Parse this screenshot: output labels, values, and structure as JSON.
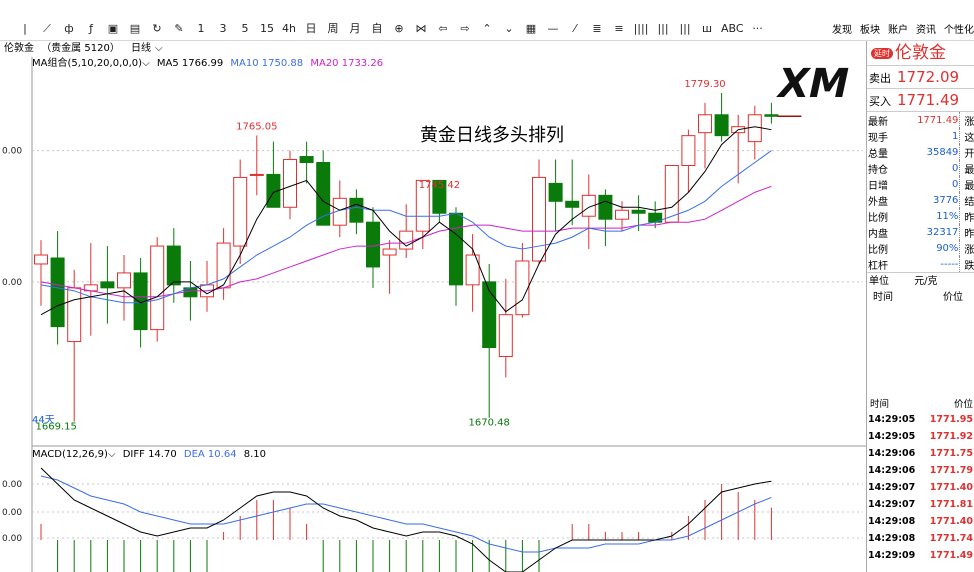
{
  "toolbar": {
    "icons": [
      {
        "name": "separator-icon",
        "glyph": "|"
      },
      {
        "name": "line-chart-icon",
        "glyph": "⟋"
      },
      {
        "name": "candle-icon",
        "glyph": "ф"
      },
      {
        "name": "indicator-icon",
        "glyph": "ƒ"
      },
      {
        "name": "chart-box-icon",
        "glyph": "▣"
      },
      {
        "name": "save-icon",
        "glyph": "▤"
      },
      {
        "name": "refresh-icon",
        "glyph": "↻"
      },
      {
        "name": "draw-icon",
        "glyph": "✎"
      },
      {
        "name": "period-1-icon",
        "glyph": "1"
      },
      {
        "name": "period-3-icon",
        "glyph": "3"
      },
      {
        "name": "period-5-icon",
        "glyph": "5"
      },
      {
        "name": "period-15-icon",
        "glyph": "15"
      },
      {
        "name": "period-4h-icon",
        "glyph": "4h"
      },
      {
        "name": "period-day-icon",
        "glyph": "日"
      },
      {
        "name": "period-week-icon",
        "glyph": "周"
      },
      {
        "name": "period-month-icon",
        "glyph": "月"
      },
      {
        "name": "period-custom-icon",
        "glyph": "自"
      },
      {
        "name": "target-icon",
        "glyph": "⊕"
      },
      {
        "name": "bowtie-icon",
        "glyph": "⋈"
      },
      {
        "name": "arrow-left-icon",
        "glyph": "⇦"
      },
      {
        "name": "arrow-right-icon",
        "glyph": "⇨"
      },
      {
        "name": "chevron-up-icon",
        "glyph": "⌃"
      },
      {
        "name": "chevron-down-icon",
        "glyph": "⌄"
      },
      {
        "name": "grid-icon",
        "glyph": "▦"
      },
      {
        "name": "hline-icon",
        "glyph": "—"
      },
      {
        "name": "slash-icon",
        "glyph": "⁄"
      },
      {
        "name": "list-icon",
        "glyph": "≣"
      },
      {
        "name": "list2-icon",
        "glyph": "≡"
      },
      {
        "name": "bars4-icon",
        "glyph": "||||"
      },
      {
        "name": "bars3-icon",
        "glyph": "|||"
      },
      {
        "name": "bars2-icon",
        "glyph": "|||"
      },
      {
        "name": "volume-icon",
        "glyph": "ш"
      },
      {
        "name": "abc-icon",
        "glyph": "ABC"
      },
      {
        "name": "more-icon",
        "glyph": "···"
      }
    ],
    "right": [
      "发现",
      "板块",
      "账户",
      "资讯",
      "个性化"
    ]
  },
  "symbol_bar": {
    "name": "伦敦金",
    "market": "（贵金属 5120）",
    "period": "日线"
  },
  "ma_legend": {
    "group": "MA组合(5,10,20,0,0,0)",
    "ma5": "MA5 1766.99",
    "ma10": "MA10 1750.88",
    "ma20": "MA20 1733.26"
  },
  "macd_legend": {
    "title": "MACD(12,26,9)",
    "diff": "DIFF 14.70",
    "dea": "DEA 10.64",
    "macd": "8.10"
  },
  "overlay_title": "黄金日线多头排列",
  "logo_text": "XM",
  "colors": {
    "up": "#e03030",
    "down": "#0a7a0a",
    "ma5": "#000000",
    "ma10": "#3a6ee8",
    "ma20": "#cc22cc",
    "grid": "#c8c8c8"
  },
  "chart_data": {
    "type": "candlestick",
    "ylim": [
      1661,
      1787
    ],
    "y_ticks": [
      {
        "value": 1760,
        "label": "0.00"
      },
      {
        "value": 1716,
        "label": "0.00"
      }
    ],
    "macd_ticks": [
      {
        "label": "0.00"
      },
      {
        "label": "0.00"
      },
      {
        "label": "0.00"
      }
    ],
    "annotations": [
      {
        "label": "1765.05",
        "index": 13,
        "value": 1765.05,
        "color": "red"
      },
      {
        "label": "1745.42",
        "index": 24,
        "value": 1745.42,
        "color": "red"
      },
      {
        "label": "1779.30",
        "index": 40,
        "value": 1779.3,
        "color": "red"
      },
      {
        "label": "1669.15",
        "index": 2,
        "value": 1669.15,
        "color": "green"
      },
      {
        "label": "1670.48",
        "index": 27,
        "value": 1670.48,
        "color": "green"
      },
      {
        "label": "44天",
        "index": 0,
        "value": 1669,
        "color": "blue"
      }
    ],
    "candles": [
      {
        "o": 1722,
        "h": 1730,
        "l": 1708,
        "c": 1725
      },
      {
        "o": 1724,
        "h": 1733,
        "l": 1695,
        "c": 1701
      },
      {
        "o": 1696,
        "h": 1720,
        "l": 1669.15,
        "c": 1714
      },
      {
        "o": 1713,
        "h": 1729,
        "l": 1698,
        "c": 1715
      },
      {
        "o": 1716,
        "h": 1728,
        "l": 1702,
        "c": 1714
      },
      {
        "o": 1714,
        "h": 1725,
        "l": 1703,
        "c": 1719
      },
      {
        "o": 1719,
        "h": 1724,
        "l": 1694,
        "c": 1700
      },
      {
        "o": 1700,
        "h": 1731,
        "l": 1696,
        "c": 1728
      },
      {
        "o": 1728,
        "h": 1734,
        "l": 1709,
        "c": 1715
      },
      {
        "o": 1714,
        "h": 1723,
        "l": 1703,
        "c": 1711
      },
      {
        "o": 1711,
        "h": 1723,
        "l": 1706,
        "c": 1715
      },
      {
        "o": 1714,
        "h": 1734,
        "l": 1710,
        "c": 1729
      },
      {
        "o": 1728,
        "h": 1757,
        "l": 1722,
        "c": 1751
      },
      {
        "o": 1752,
        "h": 1765.05,
        "l": 1745,
        "c": 1752
      },
      {
        "o": 1752,
        "h": 1763,
        "l": 1743,
        "c": 1741
      },
      {
        "o": 1741,
        "h": 1760,
        "l": 1737,
        "c": 1757
      },
      {
        "o": 1758,
        "h": 1763,
        "l": 1749,
        "c": 1756
      },
      {
        "o": 1756,
        "h": 1760,
        "l": 1742,
        "c": 1735
      },
      {
        "o": 1735,
        "h": 1750,
        "l": 1731,
        "c": 1744
      },
      {
        "o": 1744,
        "h": 1747,
        "l": 1732,
        "c": 1736
      },
      {
        "o": 1736,
        "h": 1741,
        "l": 1714,
        "c": 1721
      },
      {
        "o": 1725,
        "h": 1730,
        "l": 1712,
        "c": 1727
      },
      {
        "o": 1727,
        "h": 1742,
        "l": 1724,
        "c": 1733
      },
      {
        "o": 1733,
        "h": 1749,
        "l": 1727,
        "c": 1750
      },
      {
        "o": 1750,
        "h": 1745.42,
        "l": 1736,
        "c": 1739
      },
      {
        "o": 1739,
        "h": 1741,
        "l": 1708,
        "c": 1715
      },
      {
        "o": 1715,
        "h": 1732,
        "l": 1706,
        "c": 1725
      },
      {
        "o": 1716,
        "h": 1722,
        "l": 1670.48,
        "c": 1694
      },
      {
        "o": 1691,
        "h": 1717,
        "l": 1684,
        "c": 1705
      },
      {
        "o": 1705,
        "h": 1729,
        "l": 1704,
        "c": 1723
      },
      {
        "o": 1723,
        "h": 1757,
        "l": 1722,
        "c": 1751
      },
      {
        "o": 1749,
        "h": 1757,
        "l": 1733,
        "c": 1743
      },
      {
        "o": 1743,
        "h": 1757,
        "l": 1735,
        "c": 1741
      },
      {
        "o": 1738,
        "h": 1752,
        "l": 1727,
        "c": 1745
      },
      {
        "o": 1745,
        "h": 1747,
        "l": 1728,
        "c": 1737
      },
      {
        "o": 1737,
        "h": 1743,
        "l": 1733,
        "c": 1740
      },
      {
        "o": 1740,
        "h": 1745,
        "l": 1733,
        "c": 1739
      },
      {
        "o": 1739,
        "h": 1743,
        "l": 1734,
        "c": 1736
      },
      {
        "o": 1736,
        "h": 1755,
        "l": 1736,
        "c": 1755
      },
      {
        "o": 1755,
        "h": 1767,
        "l": 1746,
        "c": 1765
      },
      {
        "o": 1766,
        "h": 1776,
        "l": 1754,
        "c": 1772
      },
      {
        "o": 1772,
        "h": 1779.3,
        "l": 1763,
        "c": 1765
      },
      {
        "o": 1766,
        "h": 1772,
        "l": 1749,
        "c": 1768
      },
      {
        "o": 1763,
        "h": 1775,
        "l": 1757,
        "c": 1772
      },
      {
        "o": 1772,
        "h": 1776,
        "l": 1769,
        "c": 1771.49
      }
    ],
    "ma5": [
      1705,
      1708,
      1710,
      1711,
      1712,
      1713,
      1709,
      1711,
      1716,
      1716,
      1712,
      1715,
      1725,
      1737,
      1746,
      1748,
      1750,
      1743,
      1740,
      1742,
      1740,
      1733,
      1728,
      1731,
      1736,
      1732,
      1727,
      1713,
      1706,
      1710,
      1722,
      1732,
      1737,
      1741,
      1743,
      1741,
      1741,
      1740,
      1741,
      1746,
      1753,
      1762,
      1767,
      1768,
      1767
    ],
    "ma10": [
      1715,
      1714,
      1713,
      1711,
      1710,
      1709,
      1709,
      1710,
      1712,
      1714,
      1715,
      1717,
      1721,
      1725,
      1728,
      1731,
      1735,
      1738,
      1740,
      1741,
      1740,
      1740,
      1738,
      1738,
      1738,
      1739,
      1736,
      1731,
      1728,
      1727,
      1728,
      1729,
      1731,
      1734,
      1733,
      1733,
      1735,
      1736,
      1738,
      1740,
      1743,
      1748,
      1752,
      1756,
      1760
    ],
    "ma20": [
      1716,
      1715,
      1714,
      1713,
      1712,
      1711,
      1711,
      1711,
      1712,
      1713,
      1713,
      1714,
      1716,
      1717,
      1719,
      1721,
      1723,
      1725,
      1727,
      1728,
      1728,
      1729,
      1729,
      1731,
      1733,
      1734,
      1735,
      1735,
      1734,
      1733,
      1733,
      1733,
      1734,
      1734,
      1734,
      1734,
      1735,
      1735,
      1736,
      1736,
      1737,
      1740,
      1743,
      1746,
      1748
    ],
    "diff": [
      18,
      14,
      10,
      8,
      6,
      4,
      2,
      1,
      2,
      3,
      3,
      5,
      8,
      11,
      12,
      12,
      11,
      8,
      6,
      5,
      3,
      2,
      1,
      2,
      2,
      1,
      -1,
      -5,
      -8,
      -8,
      -5,
      -2,
      0,
      0,
      0,
      0,
      0,
      0,
      1,
      4,
      8,
      12,
      13,
      14,
      14.7
    ],
    "dea": [
      16,
      15,
      13,
      11,
      10,
      9,
      7,
      6,
      5,
      4,
      4,
      4,
      5,
      6,
      7,
      8,
      9,
      9,
      8,
      7,
      6,
      5,
      4,
      4,
      3,
      2,
      1,
      -1,
      -2,
      -3,
      -3,
      -2,
      -2,
      -2,
      -1,
      -1,
      -1,
      0,
      0,
      1,
      3,
      5,
      7,
      9,
      10.64
    ],
    "macd": [
      4,
      -2,
      -6,
      -6,
      -8,
      -10,
      -10,
      -10,
      -6,
      -2,
      -2,
      2,
      6,
      10,
      10,
      8,
      4,
      -2,
      -4,
      -4,
      -6,
      -6,
      -6,
      -4,
      -2,
      -2,
      -4,
      -8,
      -12,
      -10,
      -4,
      0,
      4,
      4,
      2,
      2,
      2,
      0,
      2,
      6,
      10,
      14,
      12,
      10,
      8.1
    ]
  },
  "side": {
    "badge": "延时",
    "name": "伦敦金",
    "sell_label": "卖出",
    "sell_value": "1772.09",
    "buy_label": "买入",
    "buy_value": "1771.49",
    "stats": [
      {
        "k": "最新",
        "v": "1771.49",
        "c": "red",
        "x": "涨"
      },
      {
        "k": "现手",
        "v": "1",
        "c": "blue",
        "x": "这"
      },
      {
        "k": "总量",
        "v": "35849",
        "c": "blue",
        "x": "开"
      },
      {
        "k": "持仓",
        "v": "0",
        "c": "blue",
        "x": "最"
      },
      {
        "k": "日增",
        "v": "0",
        "c": "blue",
        "x": "最"
      },
      {
        "k": "外盘",
        "v": "3776",
        "c": "blue",
        "x": "结"
      },
      {
        "k": "比例",
        "v": "11%",
        "c": "blue",
        "x": "昨"
      },
      {
        "k": "内盘",
        "v": "32317",
        "c": "blue",
        "x": "昨"
      },
      {
        "k": "比例",
        "v": "90%",
        "c": "blue",
        "x": "涨"
      },
      {
        "k": "杠杆",
        "v": "-----",
        "c": "blue",
        "x": "跌"
      }
    ],
    "unit_label": "单位",
    "unit_value": "元/克",
    "time_label": "时间",
    "price_label": "价位",
    "ticks_header_time": "时间",
    "ticks_header_price": "价位",
    "ticks": [
      {
        "t": "14:29:05",
        "p": "1771.95"
      },
      {
        "t": "14:29:05",
        "p": "1771.92"
      },
      {
        "t": "14:29:06",
        "p": "1771.75"
      },
      {
        "t": "14:29:06",
        "p": "1771.79"
      },
      {
        "t": "14:29:07",
        "p": "1771.40"
      },
      {
        "t": "14:29:07",
        "p": "1771.81"
      },
      {
        "t": "14:29:08",
        "p": "1771.40"
      },
      {
        "t": "14:29:08",
        "p": "1771.74"
      },
      {
        "t": "14:29:09",
        "p": "1771.49"
      }
    ]
  }
}
